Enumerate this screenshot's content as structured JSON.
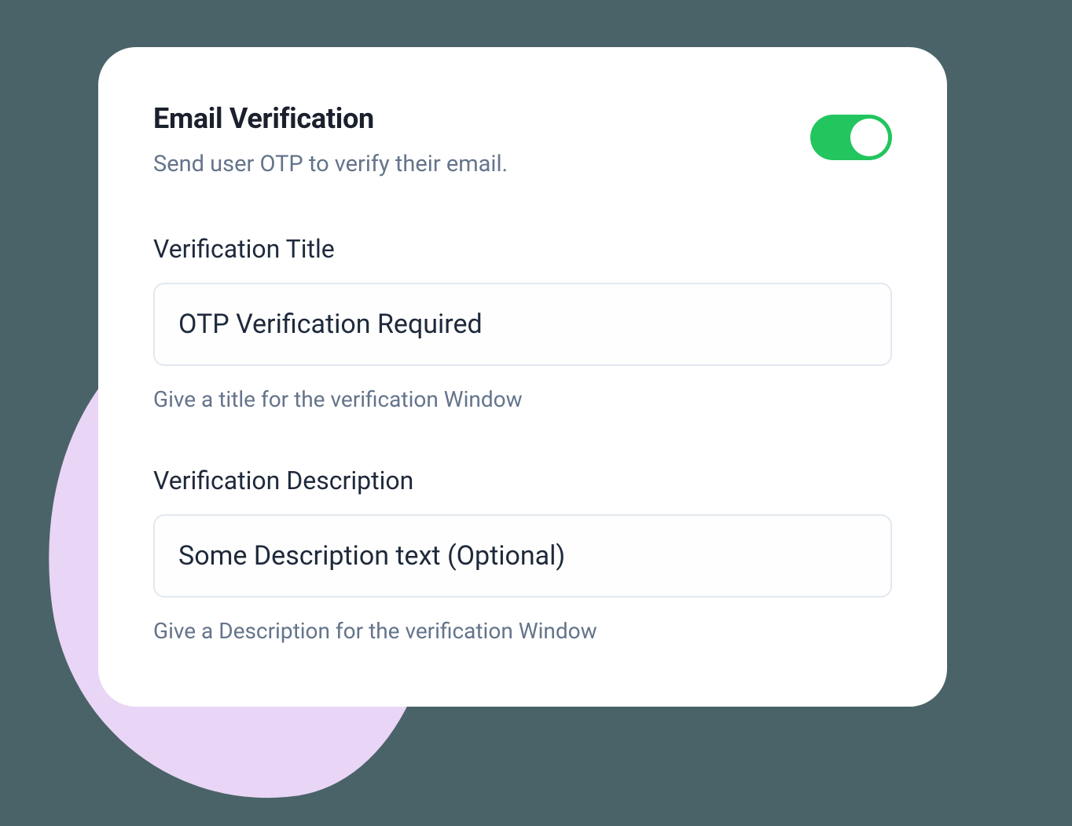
{
  "header": {
    "title": "Email Verification",
    "subtitle": "Send user OTP to verify their email.",
    "toggle_on": true
  },
  "fields": {
    "title": {
      "label": "Verification Title",
      "value": "OTP Verification Required",
      "hint": "Give a title for the verification Window"
    },
    "description": {
      "label": "Verification Description",
      "value": "Some Description text (Optional)",
      "hint": "Give a Description for the verification Window"
    }
  }
}
